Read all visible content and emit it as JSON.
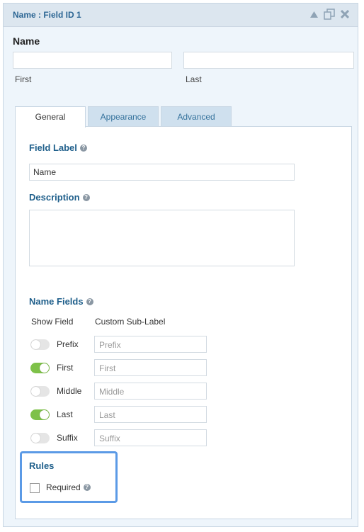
{
  "header": {
    "title": "Name : Field ID 1",
    "icons": [
      "collapse-icon",
      "duplicate-icon",
      "close-icon"
    ]
  },
  "preview": {
    "label": "Name",
    "first_sub": "First",
    "last_sub": "Last"
  },
  "tabs": [
    {
      "label": "General"
    },
    {
      "label": "Appearance"
    },
    {
      "label": "Advanced"
    }
  ],
  "general": {
    "field_label": {
      "title": "Field Label",
      "value": "Name"
    },
    "description": {
      "title": "Description",
      "value": ""
    },
    "name_fields": {
      "title": "Name Fields",
      "col_show": "Show Field",
      "col_sublabel": "Custom Sub-Label",
      "rows": [
        {
          "label": "Prefix",
          "enabled": false,
          "placeholder": "Prefix"
        },
        {
          "label": "First",
          "enabled": true,
          "placeholder": "First"
        },
        {
          "label": "Middle",
          "enabled": false,
          "placeholder": "Middle"
        },
        {
          "label": "Last",
          "enabled": true,
          "placeholder": "Last"
        },
        {
          "label": "Suffix",
          "enabled": false,
          "placeholder": "Suffix"
        }
      ]
    },
    "rules": {
      "title": "Rules",
      "required_label": "Required",
      "required_checked": false
    }
  },
  "colors": {
    "accent": "#1f5f8b",
    "toggle_on": "#7ec149",
    "toggle_off": "#e5e5e5",
    "highlight": "#5b9ae6"
  }
}
